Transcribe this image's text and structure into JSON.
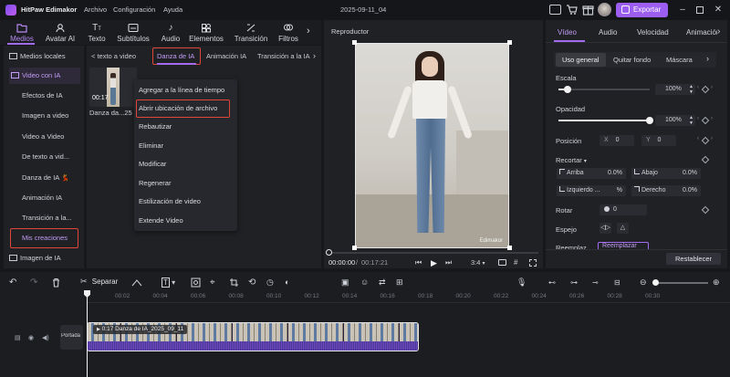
{
  "app": {
    "name": "HitPaw Edimakor",
    "date_title": "2025-09-11_04",
    "export_label": "Exportar"
  },
  "menu": [
    "Archivo",
    "Configuración",
    "Ayuda"
  ],
  "media_tabs": [
    "Medios",
    "Avatar AI",
    "Texto",
    "Subtítulos",
    "Audio",
    "Elementos",
    "Transición",
    "Filtros"
  ],
  "sidebar": {
    "items": [
      "Medios locales",
      "Video con IA",
      "Efectos de IA",
      "Imagen a video",
      "Video a Video",
      "De texto a vid...",
      "Danza de IA",
      "Animación IA",
      "Transición a la...",
      "Mis creaciones",
      "Imagen de IA"
    ],
    "dance_emoji": "💃"
  },
  "subtabs": [
    "< texto a video",
    "Danza de IA",
    "Animación IA",
    "Transición a la IA"
  ],
  "media_item": {
    "duration": "00:17",
    "name": "Danza da...25"
  },
  "context_menu": [
    "Agregar a la línea de tiempo",
    "Abrir ubicación de archivo",
    "Rebautizar",
    "Eliminar",
    "Modificar",
    "Regenerar",
    "Estilización de video",
    "Extende Video"
  ],
  "player": {
    "title": "Reproductor",
    "current_time": "00:00:00",
    "total_time": "00:17:21",
    "ratio": "3:4",
    "watermark": "Edimakor",
    "progress": 0
  },
  "properties": {
    "tabs": [
      "Vídeo",
      "Audio",
      "Velocidad",
      "Animación"
    ],
    "subtabs": [
      "Uso general",
      "Quitar fondo",
      "Máscara"
    ],
    "scale_label": "Escala",
    "scale_value": "100%",
    "scale_level": 0.1,
    "opacity_label": "Opacidad",
    "opacity_value": "100%",
    "opacity_level": 1.0,
    "position_label": "Posición",
    "pos_x_label": "X",
    "pos_x": "0",
    "pos_y_label": "Y",
    "pos_y": "0",
    "crop_label": "Recortar",
    "crop_fields": [
      {
        "name": "Arriba",
        "value": "0.0%"
      },
      {
        "name": "Abajo",
        "value": "0.0%"
      },
      {
        "name": "Izquierdo ...",
        "value": "%"
      },
      {
        "name": "Derecho",
        "value": "0.0%"
      }
    ],
    "rotate_label": "Rotar",
    "rotate_value": "0",
    "mirror_label": "Espejo",
    "partial_label": "Reemplaz",
    "partial_tab": "Reemplazar",
    "reset_label": "Restablecer"
  },
  "timeline": {
    "split_label": "Separar",
    "ruler": [
      "00:00",
      "00:02",
      "00:04",
      "00:06",
      "00:08",
      "00:10",
      "00:12",
      "00:14",
      "00:16",
      "00:18",
      "00:20",
      "00:22",
      "00:24",
      "00:26",
      "00:28",
      "00:30"
    ],
    "track_label": "Portada",
    "clip_label": "0:17 Danza de IA_2025_09_11"
  },
  "colors": {
    "accent": "#a36cf0",
    "highlight_box": "#e0453a",
    "background": "#17181b",
    "panel": "#202125"
  }
}
